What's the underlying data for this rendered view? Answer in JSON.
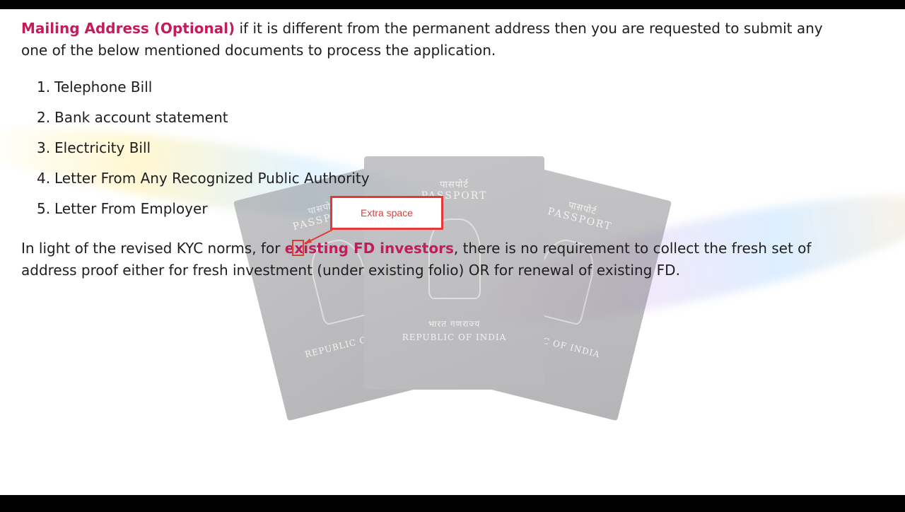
{
  "paragraph1": {
    "highlight": "Mailing Address (Optional)",
    "text": " if it is different from the permanent address then you are requested to  submit any one of the below mentioned documents to process the application."
  },
  "documents": [
    {
      "num": "1.",
      "label": "Telephone Bill"
    },
    {
      "num": "2.",
      "label": "Bank account statement"
    },
    {
      "num": "3.",
      "label": "Electricity Bill"
    },
    {
      "num": "4.",
      "label": "Letter From Any Recognized Public Authority"
    },
    {
      "num": "5.",
      "label": "Letter From Employer"
    }
  ],
  "paragraph2": {
    "before": "In light of the  revised  KYC norms, for ",
    "highlight": "existing  FD investors",
    "after": ", there is no requirement to collect the fresh set of address proof either for fresh investment (under existing  folio) OR for renewal of existing FD."
  },
  "callout": {
    "label": "Extra space"
  },
  "passport": {
    "hindi": "पासपोर्ट",
    "english": "PASSPORT",
    "republic_hindi": "भारत गणराज्य",
    "republic": "REPUBLIC OF INDIA"
  },
  "colors": {
    "accent": "#c21d5b",
    "annotation": "#e53935"
  }
}
